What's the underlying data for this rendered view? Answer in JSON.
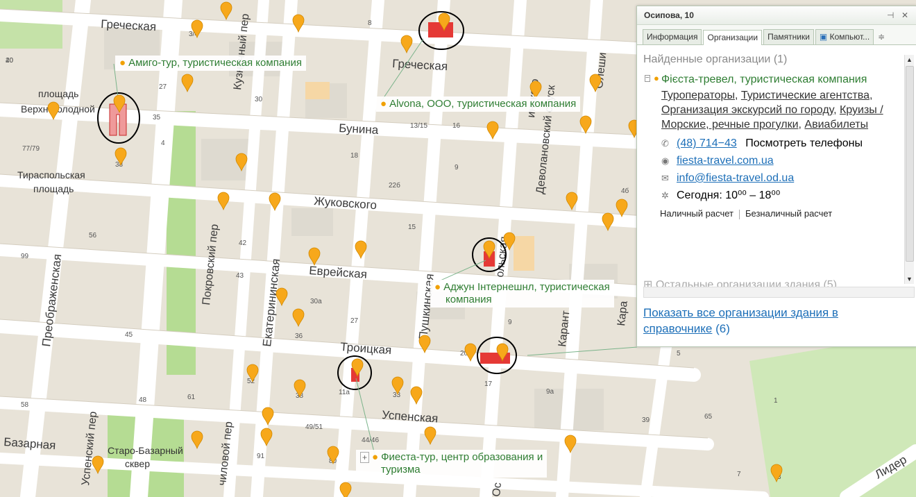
{
  "map": {
    "streets": {
      "grecheskaya_w": "Греческая",
      "grecheskaya_e": "Греческая",
      "bunina": "Бунина",
      "zhukovskogo": "Жуковского",
      "evreyskaya": "Еврейская",
      "troitskaya": "Троицкая",
      "uspenskaya": "Успенская",
      "preobrazhenskaya": "Преображенская",
      "pokrovsky": "Покровский пер",
      "ekaterininskaya": "Екатерининская",
      "pushkinskaya": "Пушкинская",
      "devolanovsky": "Деволановский спуск",
      "karantinnaya": "Карант",
      "uspensky_per": "Успенский пер",
      "bazarnaya": "Базарная",
      "lidersky": "Лидер",
      "kuznechny": "Кузнечный пер",
      "chilovoy": "чиловой пер",
      "olesha": "Олеши",
      "inskogo": "инского",
      "os": "Ос",
      "olskaya": "ольская",
      "kara": "Кара"
    },
    "places": {
      "verkhnyaya_l1": "площадь",
      "verkhnyaya_l2": "Верхнеголодной",
      "tiraspolskaya_l1": "Тираспольская",
      "tiraspolskaya_l2": "площадь",
      "starobazarny_l1": "Старо-Базарный",
      "starobazarny_l2": "сквер"
    },
    "house_numbers": [
      "40",
      "3/4",
      "8",
      "27",
      "30",
      "35",
      "39",
      "38",
      "4",
      "77/79",
      "18",
      "22б",
      "15",
      "16",
      "56",
      "42",
      "43",
      "52",
      "99",
      "45",
      "30а",
      "36",
      "27",
      "20",
      "17",
      "9",
      "9а",
      "11а",
      "33",
      "38",
      "48",
      "58",
      "91",
      "49/51",
      "80",
      "44/46",
      "39",
      "65",
      "5",
      "1",
      "3",
      "7",
      "4б",
      "9",
      "13/15",
      "61",
      "20"
    ],
    "callouts": {
      "amigo": "Амиго-тур, туристическая компания",
      "alvona": "Alvona, ООО, туристическая компания",
      "adzhun_l1": "Аджун Інтернешнл, туристическая",
      "adzhun_l2": "компания",
      "fiesta_l1": "Фиеста-тур, центр образования и",
      "fiesta_l2": "туризма"
    },
    "colors": {
      "pin": "#f7a81b",
      "building_highlight": "#e53935",
      "callout_text": "#2e7d32",
      "park": "#b5dc93",
      "street": "#ffffff",
      "block": "#e7e2d7"
    }
  },
  "panel": {
    "title": "Осипова, 10",
    "pin_label": "⊣",
    "close_label": "✕",
    "tabs": [
      "Информация",
      "Организации",
      "Памятники",
      "Компьют..."
    ],
    "tab_more": "≑",
    "found_label": "Найденные организации (1)",
    "org_name": "Фієста-тревел, туристическая компания",
    "categories": [
      "Туроператоры",
      "Туристические агентства",
      "Организация экскурсий по городу",
      "Круизы / Морские, речные прогулки",
      "Авиабилеты"
    ],
    "phone": "(48) 714−43",
    "phone_more": "Посмотреть телефоны",
    "website": "fiesta-travel.com.ua",
    "email": "info@fiesta-travel.od.ua",
    "hours": "Сегодня: 10⁰⁰ – 18⁰⁰",
    "payment_cash": "Наличный расчет",
    "payment_card": "Безналичный расчет",
    "other_orgs": "Остальные организации здания (5)",
    "show_all_link": "Показать все организации здания в справочнике",
    "show_all_count": "(6)"
  }
}
